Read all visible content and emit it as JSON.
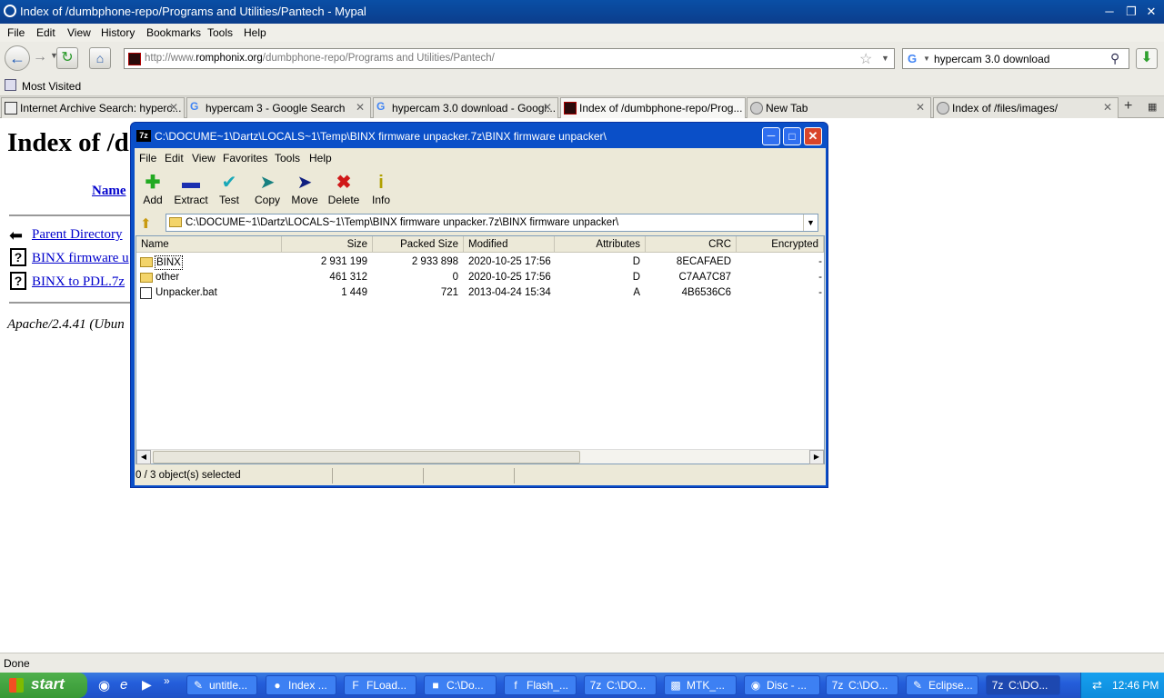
{
  "browser": {
    "title": "Index of /dumbphone-repo/Programs and Utilities/Pantech - Mypal",
    "menu": [
      "File",
      "Edit",
      "View",
      "History",
      "Bookmarks",
      "Tools",
      "Help"
    ],
    "url_prefix": "http://www.",
    "url_domain": "romphonix.org",
    "url_rest": "/dumbphone-repo/Programs and Utilities/Pantech/",
    "search_value": "hypercam 3.0 download",
    "bookmarks_label": "Most Visited",
    "tabs": [
      {
        "label": "Internet Archive Search: hyperc..."
      },
      {
        "label": "hypercam 3 - Google Search"
      },
      {
        "label": "hypercam 3.0 download - Googl..."
      },
      {
        "label": "Index of /dumbphone-repo/Prog..."
      },
      {
        "label": "New Tab"
      },
      {
        "label": "Index of /files/images/"
      }
    ],
    "status": "Done"
  },
  "page": {
    "heading": "Index of /d",
    "name_col": "Name",
    "links": [
      "Parent Directory",
      "BINX firmware u",
      "BINX to PDL.7z"
    ],
    "footer": "Apache/2.4.41 (Ubun"
  },
  "zip": {
    "title": "C:\\DOCUME~1\\Dartz\\LOCALS~1\\Temp\\BINX firmware unpacker.7z\\BINX firmware unpacker\\",
    "menu": [
      "File",
      "Edit",
      "View",
      "Favorites",
      "Tools",
      "Help"
    ],
    "tools": [
      "Add",
      "Extract",
      "Test",
      "Copy",
      "Move",
      "Delete",
      "Info"
    ],
    "path": "C:\\DOCUME~1\\Dartz\\LOCALS~1\\Temp\\BINX firmware unpacker.7z\\BINX firmware unpacker\\",
    "columns": [
      "Name",
      "Size",
      "Packed Size",
      "Modified",
      "Attributes",
      "CRC",
      "Encrypted"
    ],
    "rows": [
      {
        "name": "BINX",
        "size": "2 931 199",
        "packed": "2 933 898",
        "modified": "2020-10-25 17:56",
        "attr": "D",
        "crc": "8ECAFAED",
        "enc": "-"
      },
      {
        "name": "other",
        "size": "461 312",
        "packed": "0",
        "modified": "2020-10-25 17:56",
        "attr": "D",
        "crc": "C7AA7C87",
        "enc": "-"
      },
      {
        "name": "Unpacker.bat",
        "size": "1 449",
        "packed": "721",
        "modified": "2013-04-24 15:34",
        "attr": "A",
        "crc": "4B6536C6",
        "enc": "-"
      }
    ],
    "status": "0 / 3 object(s) selected"
  },
  "taskbar": {
    "start": "start",
    "items": [
      "untitle...",
      "Index ...",
      "FLoad...",
      "C:\\Do...",
      "Flash_...",
      "C:\\DO...",
      "MTK_...",
      "Disc - ...",
      "C:\\DO...",
      "Eclipse...",
      "C:\\DO..."
    ],
    "clock": "12:46 PM"
  }
}
